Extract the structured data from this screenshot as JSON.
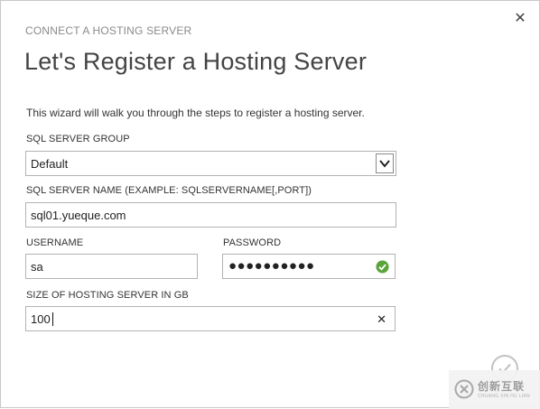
{
  "dialog": {
    "kicker": "CONNECT A HOSTING SERVER",
    "title": "Let's Register a Hosting Server",
    "description": "This wizard will walk you through the steps to register a hosting server."
  },
  "form": {
    "group_label": "SQL SERVER GROUP",
    "group_value": "Default",
    "name_label": "SQL SERVER NAME (EXAMPLE: SQLSERVERNAME[,PORT])",
    "name_value": "sql01.yueque.com",
    "username_label": "USERNAME",
    "username_value": "sa",
    "password_label": "PASSWORD",
    "password_mask": "●●●●●●●●●●",
    "size_label": "SIZE OF HOSTING SERVER IN GB",
    "size_value": "100"
  },
  "icons": {
    "close": "close-icon",
    "dropdown": "chevron-down-icon",
    "valid": "check-circle-icon",
    "clear": "clear-icon",
    "confirm": "checkmark-icon"
  },
  "colors": {
    "valid_green": "#5aa53a",
    "text": "#333333",
    "kicker": "#8a8a8a"
  },
  "watermark": {
    "name": "创新互联",
    "sub": "CHUANG XIN HU LIAN"
  }
}
